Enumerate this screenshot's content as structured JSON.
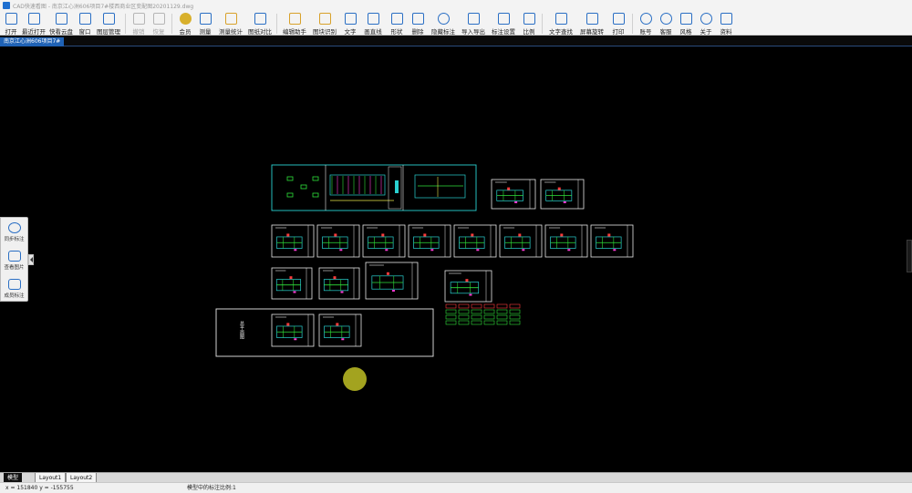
{
  "window": {
    "title": "CAD快速看图 - 南京江心洲606项目7#楼西商业区变配图20201129.dwg"
  },
  "toolbar": {
    "items": [
      {
        "label": "打开",
        "icon": "folder-open-icon",
        "enabled": true
      },
      {
        "label": "最近打开",
        "icon": "recent-files-icon",
        "enabled": true
      },
      {
        "label": "快看云盘",
        "icon": "cloud-drive-icon",
        "enabled": true
      },
      {
        "label": "窗口",
        "icon": "window-icon",
        "enabled": true
      },
      {
        "label": "图层管理",
        "icon": "layers-icon",
        "enabled": true
      },
      {
        "label": "撤销",
        "icon": "undo-icon",
        "enabled": false
      },
      {
        "label": "恢复",
        "icon": "redo-icon",
        "enabled": false
      },
      {
        "label": "会员",
        "icon": "vip-icon",
        "enabled": true
      },
      {
        "label": "测量",
        "icon": "measure-icon",
        "enabled": true
      },
      {
        "label": "测量统计",
        "icon": "measure-stats-icon",
        "enabled": true
      },
      {
        "label": "图纸对比",
        "icon": "drawing-compare-icon",
        "enabled": true
      },
      {
        "label": "编辑助手",
        "icon": "edit-assistant-icon",
        "enabled": true
      },
      {
        "label": "图块识别",
        "icon": "block-recognition-icon",
        "enabled": true
      },
      {
        "label": "文字",
        "icon": "text-icon",
        "enabled": true
      },
      {
        "label": "画直线",
        "icon": "line-icon",
        "enabled": true
      },
      {
        "label": "形状",
        "icon": "shape-icon",
        "enabled": true
      },
      {
        "label": "删除",
        "icon": "eraser-icon",
        "enabled": true
      },
      {
        "label": "隐藏标注",
        "icon": "hide-annotation-icon",
        "enabled": true
      },
      {
        "label": "导入导出",
        "icon": "import-export-icon",
        "enabled": true
      },
      {
        "label": "标注设置",
        "icon": "annotation-settings-icon",
        "enabled": true
      },
      {
        "label": "比例",
        "icon": "scale-icon",
        "enabled": true
      },
      {
        "label": "文字查找",
        "icon": "text-search-icon",
        "enabled": true
      },
      {
        "label": "屏幕旋转",
        "icon": "screen-rotate-icon",
        "enabled": true
      },
      {
        "label": "打印",
        "icon": "print-icon",
        "enabled": true
      },
      {
        "label": "账号",
        "icon": "account-icon",
        "enabled": true
      },
      {
        "label": "客服",
        "icon": "customer-service-icon",
        "enabled": true
      },
      {
        "label": "风格",
        "icon": "style-icon",
        "enabled": true
      },
      {
        "label": "关于",
        "icon": "about-icon",
        "enabled": true
      },
      {
        "label": "资料",
        "icon": "materials-icon",
        "enabled": true
      }
    ]
  },
  "document_tab": {
    "label": "南京江心洲606项目7#"
  },
  "side_panel": {
    "items": [
      {
        "label": "同步标注",
        "icon": "sync-annotation-icon"
      },
      {
        "label": "查看图片",
        "icon": "view-images-icon"
      },
      {
        "label": "成员标注",
        "icon": "member-annotation-icon"
      }
    ]
  },
  "drawing": {
    "side_caption": "总平面图",
    "colors": {
      "background": "#000000",
      "frame": "#e8e8e8",
      "frame_cyan": "#2ad1d1",
      "linework_green": "#2fe03a",
      "linework_cyan": "#2ad1d1",
      "linework_red": "#ff3b3b",
      "linework_magenta": "#ff3bd6",
      "linework_yellow": "#e8e84a",
      "cursor": "#a3a31f"
    }
  },
  "layout_tabs": [
    {
      "label": "模型",
      "active": true
    },
    {
      "label": "Layout1",
      "active": false
    },
    {
      "label": "Layout2",
      "active": false
    }
  ],
  "status": {
    "coordinates": "x = 151840  y = -155755",
    "scale_text": "模型中的标注比例:1"
  }
}
